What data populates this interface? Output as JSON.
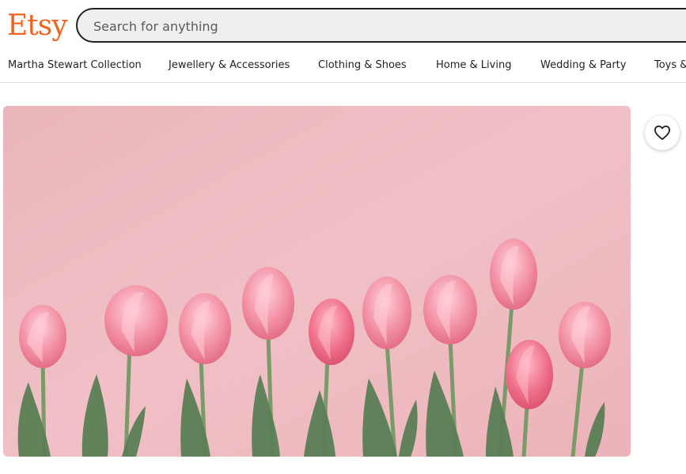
{
  "brand": {
    "logo_text": "Etsy",
    "color": "#F1641E"
  },
  "search": {
    "placeholder": "Search for anything",
    "value": ""
  },
  "nav": {
    "items": [
      {
        "label": "Martha Stewart Collection"
      },
      {
        "label": "Jewellery & Accessories"
      },
      {
        "label": "Clothing & Shoes"
      },
      {
        "label": "Home & Living"
      },
      {
        "label": "Wedding & Party"
      },
      {
        "label": "Toys &"
      }
    ]
  },
  "listing": {
    "image_subject": "pink tulips on pink background",
    "favorite_icon": "heart-outline-icon"
  },
  "colors": {
    "background": "#ffffff",
    "photo_bg": "#efbcc2",
    "tulip": "#f08a9f",
    "stem": "#5f8a5a"
  }
}
